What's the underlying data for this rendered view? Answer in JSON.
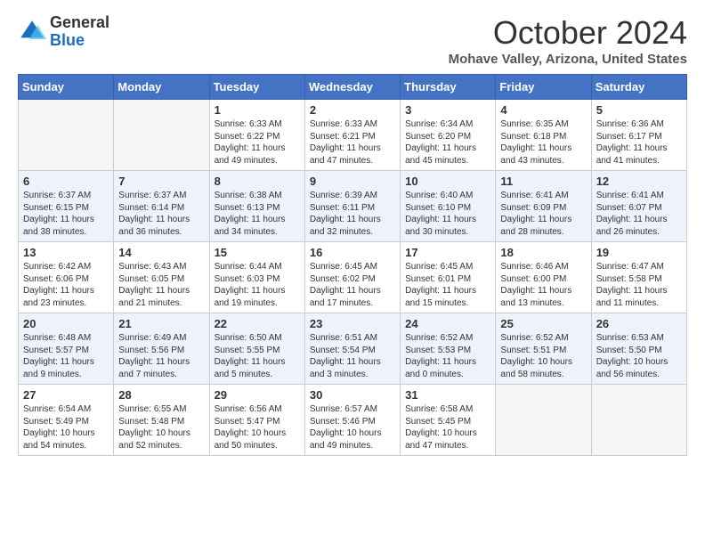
{
  "header": {
    "logo": {
      "general": "General",
      "blue": "Blue"
    },
    "title": "October 2024",
    "location": "Mohave Valley, Arizona, United States"
  },
  "calendar": {
    "days_of_week": [
      "Sunday",
      "Monday",
      "Tuesday",
      "Wednesday",
      "Thursday",
      "Friday",
      "Saturday"
    ],
    "weeks": [
      [
        {
          "num": "",
          "empty": true
        },
        {
          "num": "",
          "empty": true
        },
        {
          "num": "1",
          "sunrise": "6:33 AM",
          "sunset": "6:22 PM",
          "daylight": "11 hours and 49 minutes."
        },
        {
          "num": "2",
          "sunrise": "6:33 AM",
          "sunset": "6:21 PM",
          "daylight": "11 hours and 47 minutes."
        },
        {
          "num": "3",
          "sunrise": "6:34 AM",
          "sunset": "6:20 PM",
          "daylight": "11 hours and 45 minutes."
        },
        {
          "num": "4",
          "sunrise": "6:35 AM",
          "sunset": "6:18 PM",
          "daylight": "11 hours and 43 minutes."
        },
        {
          "num": "5",
          "sunrise": "6:36 AM",
          "sunset": "6:17 PM",
          "daylight": "11 hours and 41 minutes."
        }
      ],
      [
        {
          "num": "6",
          "sunrise": "6:37 AM",
          "sunset": "6:15 PM",
          "daylight": "11 hours and 38 minutes."
        },
        {
          "num": "7",
          "sunrise": "6:37 AM",
          "sunset": "6:14 PM",
          "daylight": "11 hours and 36 minutes."
        },
        {
          "num": "8",
          "sunrise": "6:38 AM",
          "sunset": "6:13 PM",
          "daylight": "11 hours and 34 minutes."
        },
        {
          "num": "9",
          "sunrise": "6:39 AM",
          "sunset": "6:11 PM",
          "daylight": "11 hours and 32 minutes."
        },
        {
          "num": "10",
          "sunrise": "6:40 AM",
          "sunset": "6:10 PM",
          "daylight": "11 hours and 30 minutes."
        },
        {
          "num": "11",
          "sunrise": "6:41 AM",
          "sunset": "6:09 PM",
          "daylight": "11 hours and 28 minutes."
        },
        {
          "num": "12",
          "sunrise": "6:41 AM",
          "sunset": "6:07 PM",
          "daylight": "11 hours and 26 minutes."
        }
      ],
      [
        {
          "num": "13",
          "sunrise": "6:42 AM",
          "sunset": "6:06 PM",
          "daylight": "11 hours and 23 minutes."
        },
        {
          "num": "14",
          "sunrise": "6:43 AM",
          "sunset": "6:05 PM",
          "daylight": "11 hours and 21 minutes."
        },
        {
          "num": "15",
          "sunrise": "6:44 AM",
          "sunset": "6:03 PM",
          "daylight": "11 hours and 19 minutes."
        },
        {
          "num": "16",
          "sunrise": "6:45 AM",
          "sunset": "6:02 PM",
          "daylight": "11 hours and 17 minutes."
        },
        {
          "num": "17",
          "sunrise": "6:45 AM",
          "sunset": "6:01 PM",
          "daylight": "11 hours and 15 minutes."
        },
        {
          "num": "18",
          "sunrise": "6:46 AM",
          "sunset": "6:00 PM",
          "daylight": "11 hours and 13 minutes."
        },
        {
          "num": "19",
          "sunrise": "6:47 AM",
          "sunset": "5:58 PM",
          "daylight": "11 hours and 11 minutes."
        }
      ],
      [
        {
          "num": "20",
          "sunrise": "6:48 AM",
          "sunset": "5:57 PM",
          "daylight": "11 hours and 9 minutes."
        },
        {
          "num": "21",
          "sunrise": "6:49 AM",
          "sunset": "5:56 PM",
          "daylight": "11 hours and 7 minutes."
        },
        {
          "num": "22",
          "sunrise": "6:50 AM",
          "sunset": "5:55 PM",
          "daylight": "11 hours and 5 minutes."
        },
        {
          "num": "23",
          "sunrise": "6:51 AM",
          "sunset": "5:54 PM",
          "daylight": "11 hours and 3 minutes."
        },
        {
          "num": "24",
          "sunrise": "6:52 AM",
          "sunset": "5:53 PM",
          "daylight": "11 hours and 0 minutes."
        },
        {
          "num": "25",
          "sunrise": "6:52 AM",
          "sunset": "5:51 PM",
          "daylight": "10 hours and 58 minutes."
        },
        {
          "num": "26",
          "sunrise": "6:53 AM",
          "sunset": "5:50 PM",
          "daylight": "10 hours and 56 minutes."
        }
      ],
      [
        {
          "num": "27",
          "sunrise": "6:54 AM",
          "sunset": "5:49 PM",
          "daylight": "10 hours and 54 minutes."
        },
        {
          "num": "28",
          "sunrise": "6:55 AM",
          "sunset": "5:48 PM",
          "daylight": "10 hours and 52 minutes."
        },
        {
          "num": "29",
          "sunrise": "6:56 AM",
          "sunset": "5:47 PM",
          "daylight": "10 hours and 50 minutes."
        },
        {
          "num": "30",
          "sunrise": "6:57 AM",
          "sunset": "5:46 PM",
          "daylight": "10 hours and 49 minutes."
        },
        {
          "num": "31",
          "sunrise": "6:58 AM",
          "sunset": "5:45 PM",
          "daylight": "10 hours and 47 minutes."
        },
        {
          "num": "",
          "empty": true
        },
        {
          "num": "",
          "empty": true
        }
      ]
    ]
  }
}
